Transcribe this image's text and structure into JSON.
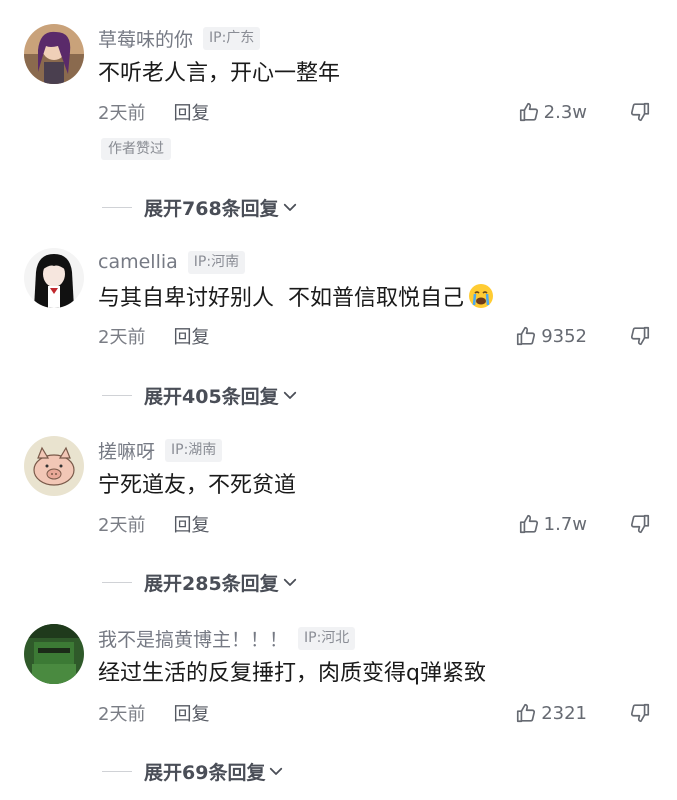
{
  "comments": [
    {
      "username": "草莓味的你",
      "ip": "IP:广东",
      "text": "不听老人言，开心一整年",
      "time": "2天前",
      "reply_label": "回复",
      "likes": "2.3w",
      "author_badge": "作者赞过",
      "expand_label": "展开768条回复"
    },
    {
      "username": "camellia",
      "ip": "IP:河南",
      "text": "与其自卑讨好别人  不如普信取悦自己",
      "emoji": "crying-face-icon",
      "time": "2天前",
      "reply_label": "回复",
      "likes": "9352",
      "expand_label": "展开405条回复"
    },
    {
      "username": "搓嘛呀",
      "ip": "IP:湖南",
      "text": "宁死道友，不死贫道",
      "time": "2天前",
      "reply_label": "回复",
      "likes": "1.7w",
      "expand_label": "展开285条回复"
    },
    {
      "username": "我不是搞黄博主！！！",
      "ip": "IP:河北",
      "text": "经过生活的反复捶打，肉质变得q弹紧致",
      "time": "2天前",
      "reply_label": "回复",
      "likes": "2321",
      "expand_label": "展开69条回复"
    }
  ],
  "colors": {
    "username": "#767a84",
    "badge_bg": "#f1f2f4",
    "text": "#1a1a1a"
  }
}
